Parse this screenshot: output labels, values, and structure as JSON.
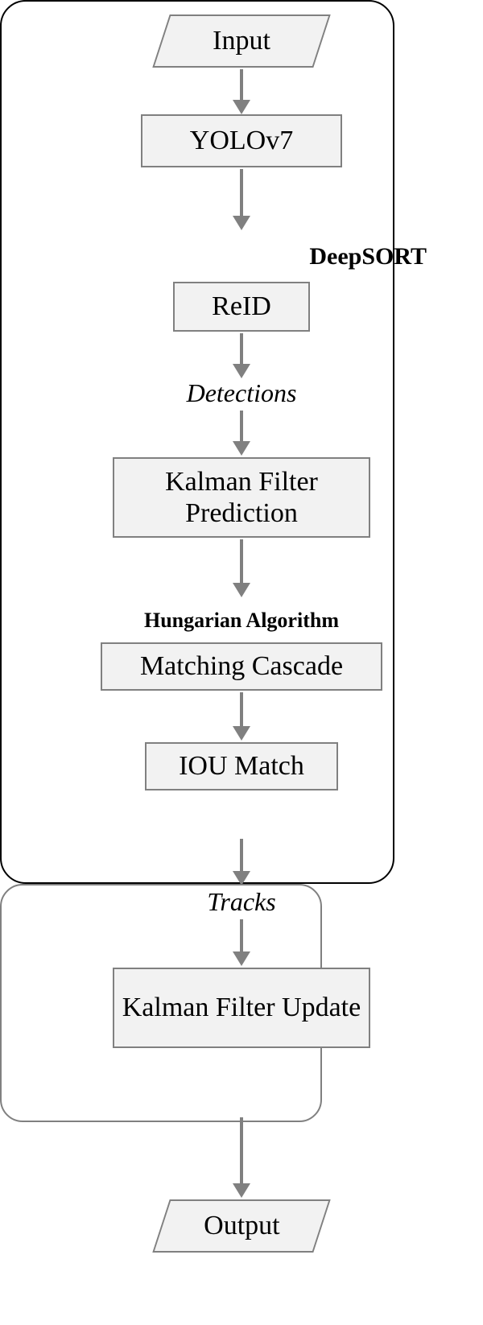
{
  "nodes": {
    "input": "Input",
    "yolo": "YOLOv7",
    "reid": "ReID",
    "detections": "Detections",
    "kf_predict": "Kalman Filter Prediction",
    "matching_cascade": "Matching Cascade",
    "iou_match": "IOU Match",
    "tracks": "Tracks",
    "kf_update": "Kalman Filter Update",
    "output": "Output"
  },
  "containers": {
    "deepsort": "DeepSORT",
    "hungarian": "Hungarian Algorithm"
  }
}
